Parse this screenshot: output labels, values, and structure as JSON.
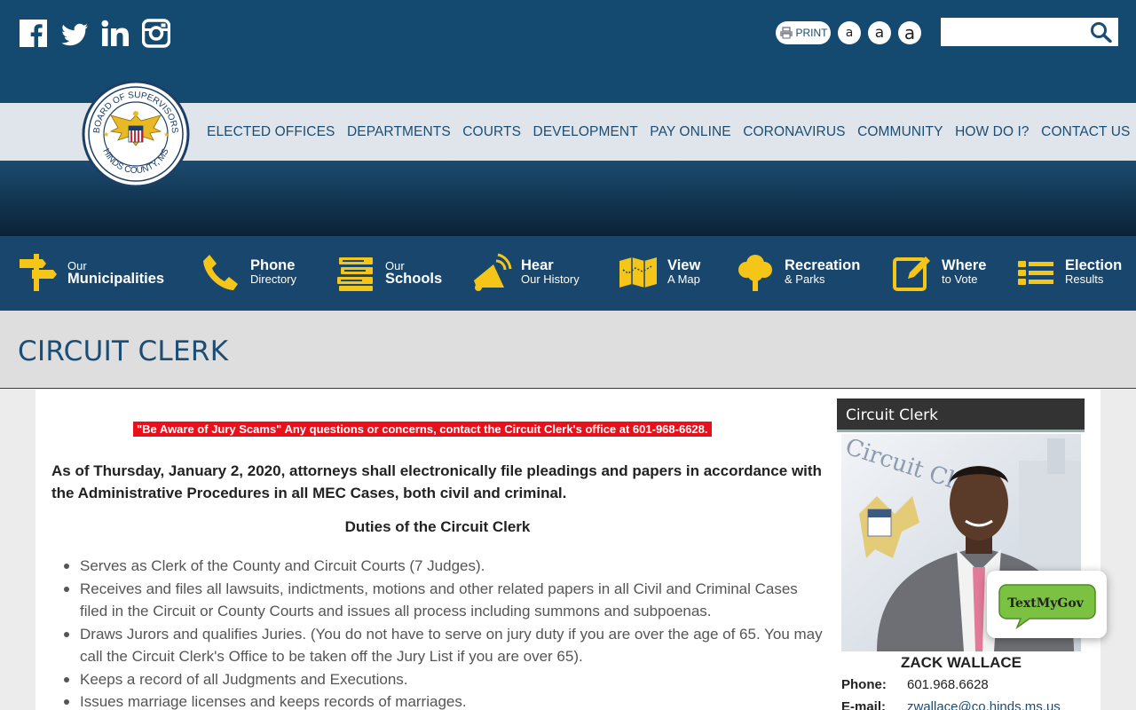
{
  "header": {
    "social": [
      "facebook-icon",
      "twitter-icon",
      "linkedin-icon",
      "instagram-icon"
    ],
    "print_label": "PRINT",
    "font_sizes": [
      "a",
      "a",
      "a"
    ],
    "search_placeholder": ""
  },
  "nav": {
    "items": [
      "ELECTED OFFICES",
      "DEPARTMENTS",
      "COURTS",
      "DEVELOPMENT",
      "PAY ONLINE",
      "CORONAVIRUS",
      "COMMUNITY",
      "HOW DO I?",
      "CONTACT US"
    ]
  },
  "quick_links": [
    {
      "top": "Our",
      "bottom": "Municipalities",
      "icon": "signpost-icon"
    },
    {
      "top": "Phone",
      "bottom": "Directory",
      "icon": "phone-icon"
    },
    {
      "top": "Our",
      "bottom": "Schools",
      "icon": "books-icon"
    },
    {
      "top": "Hear",
      "bottom": "Our History",
      "icon": "megaphone-icon"
    },
    {
      "top": "View",
      "bottom": "A Map",
      "icon": "map-icon"
    },
    {
      "top": "Recreation",
      "bottom": "& Parks",
      "icon": "tree-icon"
    },
    {
      "top": "Where",
      "bottom": "to Vote",
      "icon": "edit-icon"
    },
    {
      "top": "Election",
      "bottom": "Results",
      "icon": "list-icon"
    }
  ],
  "page": {
    "title": "CIRCUIT CLERK",
    "alert": "\"Be Aware of Jury Scams\" Any questions or concerns, contact the Circuit Clerk's office at 601-968-6628.",
    "lead": "As of Thursday, January 2, 2020, attorneys shall electronically file pleadings and papers in accordance with the Administrative Procedures in all MEC Cases, both civil and criminal.",
    "duties_title": "Duties of the Circuit Clerk",
    "duties": [
      "Serves as Clerk of the County and Circuit Courts (7 Judges).",
      "Receives and files all lawsuits, indictments, motions and other related papers in all Civil and Criminal Cases filed in the Circuit or County Courts and issues all process including summons and subpoenas.",
      "Draws Jurors and qualifies Juries. (You do not have to serve on jury duty if you are over the age of 65. You may call the Circuit Clerk's Office to be taken off the Jury List if you are over 65).",
      "Keeps a record of all Judgments and Executions.",
      "Issues marriage licenses and keeps records of marriages."
    ]
  },
  "sidebar": {
    "heading": "Circuit Clerk",
    "photo_text": "Circuit Clerk",
    "name": "ZACK WALLACE",
    "phone_label": "Phone:",
    "phone": "601.968.6628",
    "email_label": "E-mail:",
    "email": "zwallace@co.hinds.ms.us"
  },
  "seal": {
    "top_text": "BOARD OF SUPERVISORS",
    "bottom_text": "HINDS COUNTY, MS"
  },
  "widget": {
    "label": "TextMyGov"
  },
  "colors": {
    "navy": "#144a70",
    "gold": "#f5c518",
    "alert": "#e8101a"
  }
}
